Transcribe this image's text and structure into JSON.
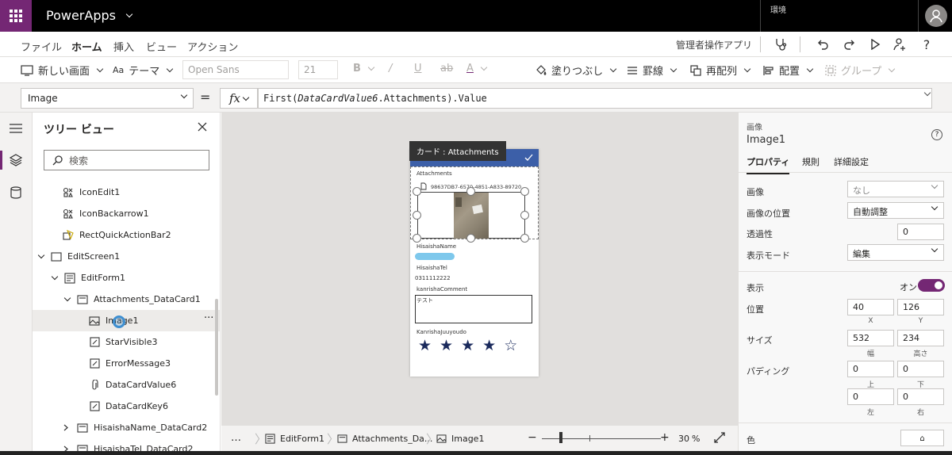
{
  "app": {
    "name": "PowerApps",
    "environment_label": "環境"
  },
  "menu": {
    "tabs": [
      {
        "label": "ファイル"
      },
      {
        "label": "ホーム",
        "active": true
      },
      {
        "label": "挿入"
      },
      {
        "label": "ビュー"
      },
      {
        "label": "アクション"
      }
    ],
    "app_checker": "管理者操作アプリ"
  },
  "toolbar": {
    "new_screen": "新しい画面",
    "theme": "テーマ",
    "font": "Open Sans",
    "font_size": "21",
    "fill": "塗りつぶし",
    "border": "罫線",
    "reorder": "再配列",
    "align": "配置",
    "group": "グループ"
  },
  "formula_bar": {
    "property": "Image",
    "equals": "=",
    "fx": "fx",
    "formula_fn": "First(",
    "formula_arg": "DataCardValue6",
    "formula_rest": ".Attachments).Value"
  },
  "tree": {
    "title": "ツリー ビュー",
    "search_placeholder": "検索",
    "items": [
      {
        "label": "IconEdit1"
      },
      {
        "label": "IconBackarrow1"
      },
      {
        "label": "RectQuickActionBar2"
      },
      {
        "label": "EditScreen1"
      },
      {
        "label": "EditForm1"
      },
      {
        "label": "Attachments_DataCard1"
      },
      {
        "label": "Image1"
      },
      {
        "label": "StarVisible3"
      },
      {
        "label": "ErrorMessage3"
      },
      {
        "label": "DataCardValue6"
      },
      {
        "label": "DataCardKey6"
      },
      {
        "label": "HisaishaName_DataCard2"
      },
      {
        "label": "HisaishaTel_DataCard2"
      }
    ]
  },
  "canvas": {
    "tooltip": "カード : Attachments",
    "attachments_label": "Attachments",
    "attachment_file": "98637DB7-6570-4851-A833-89720",
    "name_label": "HisaishaName",
    "tel_label": "HisaishaTel",
    "tel_value": "0311112222",
    "comment_label": "kanrishaComment",
    "comment_value": "テスト",
    "priority_label": "KanrishaJuuyoudo",
    "rating": {
      "filled": 4,
      "max": 5
    }
  },
  "bottom_bar": {
    "more": "…",
    "crumbs": [
      {
        "label": "EditForm1"
      },
      {
        "label": "Attachments_Da..."
      },
      {
        "label": "Image1"
      }
    ],
    "zoom_minus": "−",
    "zoom_plus": "+",
    "zoom_value": "30",
    "zoom_unit": "%"
  },
  "properties": {
    "type_label": "画像",
    "control_name": "Image1",
    "tabs": [
      {
        "label": "プロパティ",
        "active": true
      },
      {
        "label": "規則"
      },
      {
        "label": "詳細設定"
      }
    ],
    "image": {
      "label": "画像",
      "value": "なし"
    },
    "image_position": {
      "label": "画像の位置",
      "value": "自動調整"
    },
    "transparency": {
      "label": "透過性",
      "value": "0"
    },
    "display_mode": {
      "label": "表示モード",
      "value": "編集"
    },
    "visible": {
      "label": "表示",
      "value": "オン"
    },
    "position": {
      "label": "位置",
      "x": "40",
      "y": "126",
      "x_caption": "X",
      "y_caption": "Y"
    },
    "size": {
      "label": "サイズ",
      "width": "532",
      "height": "234",
      "width_caption": "幅",
      "height_caption": "高さ"
    },
    "padding": {
      "label": "パディング",
      "top": "0",
      "bottom": "0",
      "left": "0",
      "right": "0",
      "top_caption": "上",
      "bottom_caption": "下",
      "left_caption": "左",
      "right_caption": "右"
    },
    "color": {
      "label": "色"
    }
  },
  "colors": {
    "brand": "#742774",
    "form_header": "#3c5fa8",
    "star": "#1a2a5c"
  }
}
